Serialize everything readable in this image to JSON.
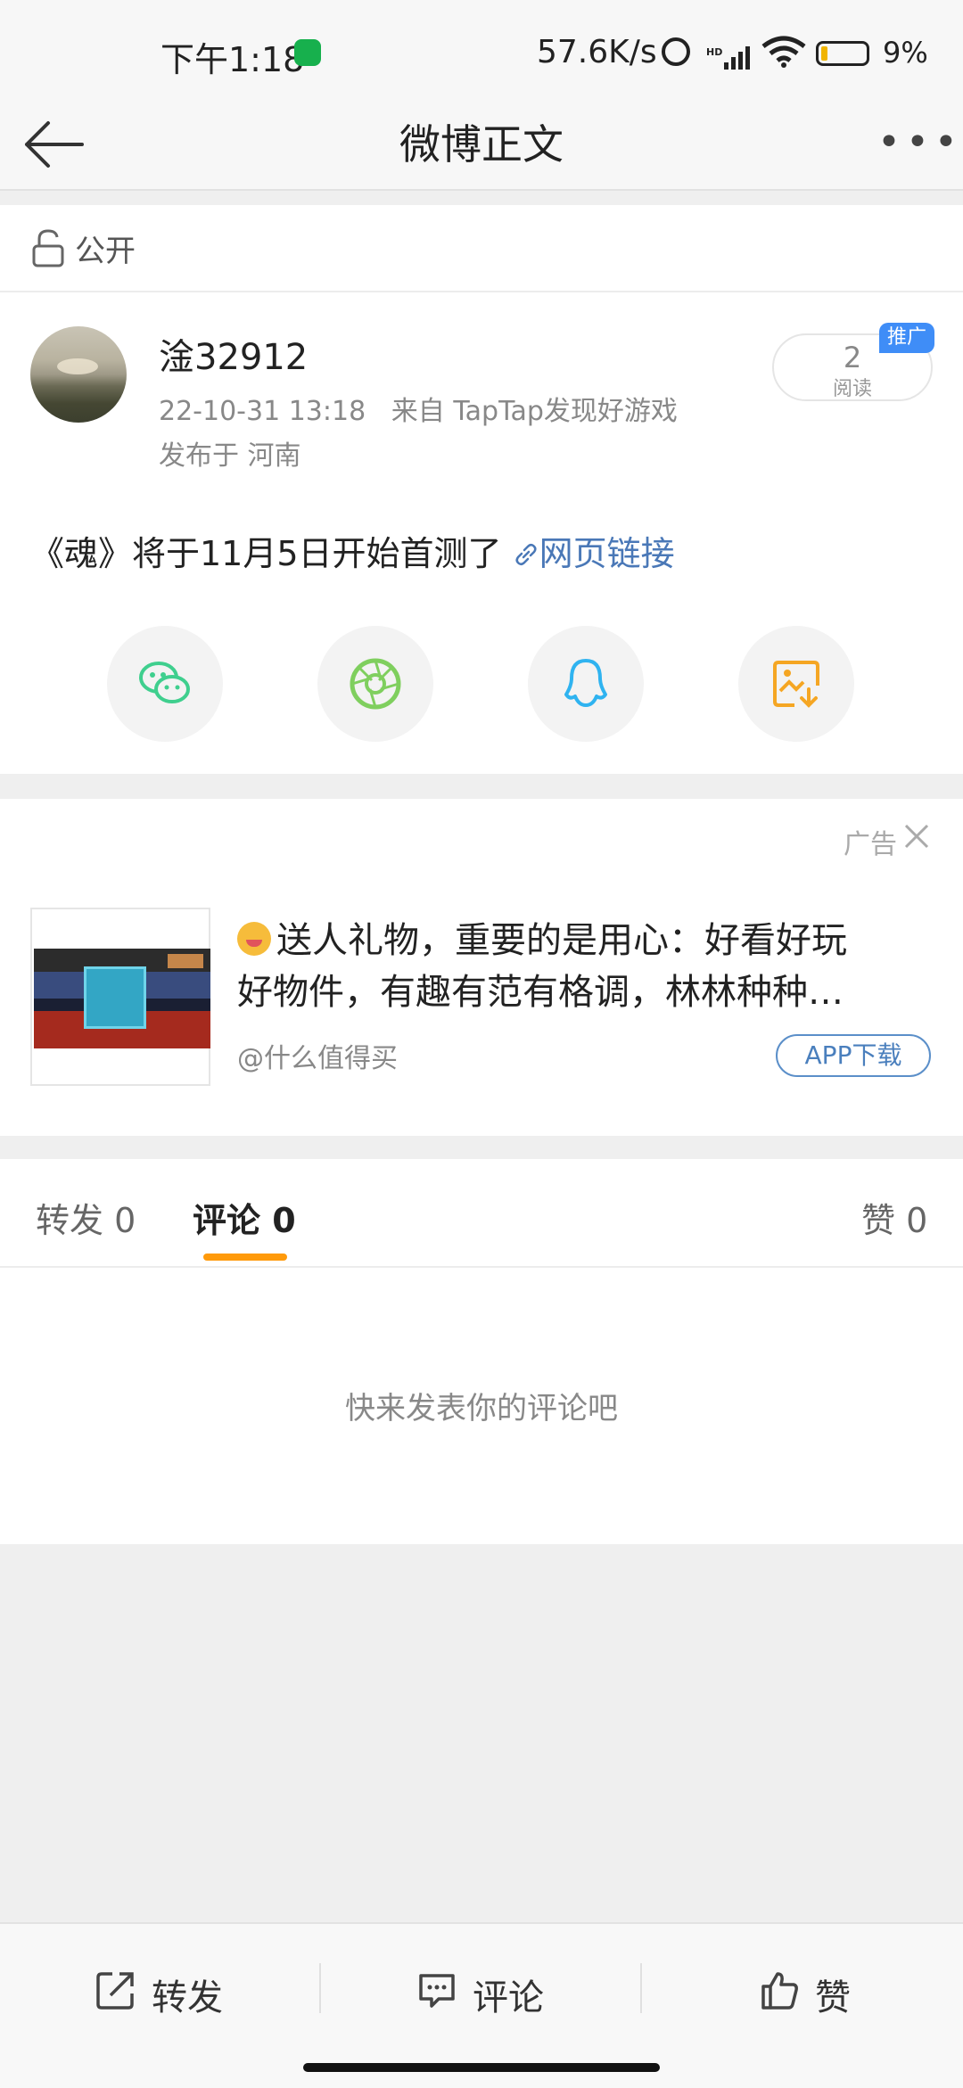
{
  "status_bar": {
    "time": "下午1:18",
    "network_speed": "57.6K/s",
    "battery_percent": "9%",
    "icons": [
      "shield-icon",
      "alarm-icon",
      "hd-signal-icon",
      "wifi-icon",
      "battery-icon"
    ]
  },
  "nav": {
    "title": "微博正文",
    "back_icon": "arrow-left-icon",
    "more_icon": "more-dots-icon",
    "more_glyph": "•••"
  },
  "visibility": {
    "label": "公开",
    "icon": "unlock-icon"
  },
  "post": {
    "username": "淦32912",
    "timestamp": "22-10-31 13:18",
    "source": "来自 TapTap发现好游戏",
    "location": "发布于 河南",
    "read_count": "2",
    "read_label": "阅读",
    "promo_badge": "推广",
    "content_text": "《魂》将于11月5日开始首测了",
    "link_text": "网页链接",
    "share_targets": [
      "wechat-icon",
      "moments-icon",
      "qq-icon",
      "save-image-icon"
    ]
  },
  "ad": {
    "ad_label": "广告",
    "headline_line1": "送人礼物，重要的是用心：好看好玩",
    "headline_line2": "好物件，有趣有范有格调，林林种种…",
    "source": "@什么值得买",
    "cta": "APP下载"
  },
  "tabs": {
    "repost": "转发 0",
    "comments": "评论 0",
    "likes": "赞 0",
    "active": "comments"
  },
  "comments": {
    "empty_text": "快来发表你的评论吧"
  },
  "bottom_bar": {
    "repost": "转发",
    "comment": "评论",
    "like": "赞"
  },
  "colors": {
    "accent_orange": "#ff9a0b",
    "link_blue": "#4a78b7",
    "promo_blue": "#3f8df7",
    "wechat_green": "#3fcf8e",
    "moments_green": "#7fcf5e",
    "qq_blue": "#2fb3f0",
    "save_orange": "#f5a623"
  }
}
